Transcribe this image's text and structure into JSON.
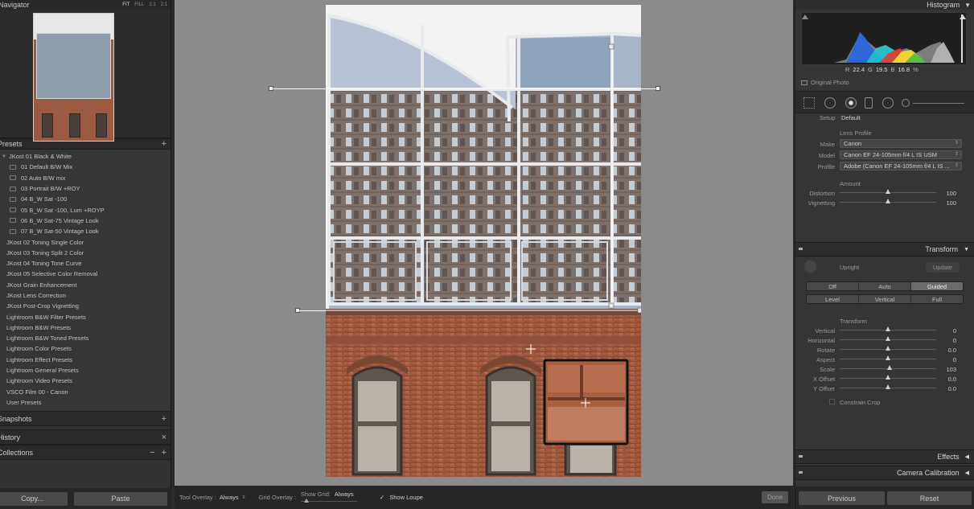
{
  "left": {
    "navigator": {
      "title": "Navigator",
      "modes": [
        "FIT",
        "FILL",
        "1:1",
        "2:1"
      ],
      "active_mode": "FIT"
    },
    "presets": {
      "title": "Presets",
      "add": "+",
      "items": [
        {
          "label": "JKost 01 Black & White",
          "kind": "folder"
        },
        {
          "label": "01 Default B/W Mix",
          "kind": "sub"
        },
        {
          "label": "02 Auto B/W mix",
          "kind": "sub"
        },
        {
          "label": "03 Portrait B/W +ROY",
          "kind": "sub"
        },
        {
          "label": "04 B_W Sat -100",
          "kind": "sub"
        },
        {
          "label": "05 B_W Sat -100, Lum +ROYP",
          "kind": "sub"
        },
        {
          "label": "06 B_W Sat-75 Vintage Look",
          "kind": "sub"
        },
        {
          "label": "07 B_W Sat-50 Vintage Look",
          "kind": "sub"
        },
        {
          "label": "JKost 02 Toning Single Color",
          "kind": "top"
        },
        {
          "label": "JKost 03 Toning Split 2 Color",
          "kind": "top"
        },
        {
          "label": "JKost 04 Toning Tone Curve",
          "kind": "top"
        },
        {
          "label": "JKost 05 Selective Color Removal",
          "kind": "top"
        },
        {
          "label": "JKost Grain Enhancement",
          "kind": "top"
        },
        {
          "label": "JKost Lens Correction",
          "kind": "top"
        },
        {
          "label": "JKost Post-Crop Vignetting",
          "kind": "top"
        },
        {
          "label": "Lightroom B&W Filter Presets",
          "kind": "top"
        },
        {
          "label": "Lightroom B&W Presets",
          "kind": "top"
        },
        {
          "label": "Lightroom B&W Toned Presets",
          "kind": "top"
        },
        {
          "label": "Lightroom Color Presets",
          "kind": "top"
        },
        {
          "label": "Lightroom Effect Presets",
          "kind": "top"
        },
        {
          "label": "Lightroom General Presets",
          "kind": "top"
        },
        {
          "label": "Lightroom Video Presets",
          "kind": "top"
        },
        {
          "label": "VSCO Film 00 - Canon",
          "kind": "top"
        },
        {
          "label": "User Presets",
          "kind": "top"
        }
      ]
    },
    "snapshots": {
      "title": "Snapshots",
      "add": "+"
    },
    "history": {
      "title": "History",
      "clear": "×"
    },
    "collections": {
      "title": "Collections",
      "minus": "−",
      "add": "+"
    },
    "copy_label": "Copy...",
    "paste_label": "Paste"
  },
  "toolbar": {
    "tool_overlay_label": "Tool Overlay :",
    "tool_overlay_value": "Always",
    "grid_overlay_label": "Grid Overlay :",
    "show_grid_label": "Show Grid:",
    "show_grid_value": "Always",
    "show_loupe_label": "Show Loupe",
    "show_loupe_checked": true,
    "done_label": "Done"
  },
  "right": {
    "histogram": {
      "title": "Histogram",
      "r_label": "R",
      "r_value": "22.4",
      "g_label": "G",
      "g_value": "19.5",
      "b_label": "B",
      "b_value": "16.8",
      "unit": "%",
      "original_photo": "Original Photo"
    },
    "lens": {
      "setup_label": "Setup",
      "setup_value": "Default",
      "profile_title": "Lens Profile",
      "make_label": "Make",
      "make_value": "Canon",
      "model_label": "Model",
      "model_value": "Canon EF 24-105mm f/4 L IS USM",
      "profile_label": "Profile",
      "profile_value": "Adobe (Canon EF 24-105mm f/4 L IS ...",
      "amount_title": "Amount",
      "distortion_label": "Distortion",
      "distortion_value": "100",
      "distortion_level": 0.5,
      "vignetting_label": "Vignetting",
      "vignetting_value": "100",
      "vignetting_level": 0.5
    },
    "transform": {
      "title": "Transform",
      "upright_label": "Upright",
      "update_label": "Update",
      "modes_row1": [
        "Off",
        "Auto",
        "Guided"
      ],
      "modes_row2": [
        "Level",
        "Vertical",
        "Full"
      ],
      "active_mode": "Guided",
      "subtitle": "Transform",
      "sliders": [
        {
          "label": "Vertical",
          "value": "0",
          "level": 0.5
        },
        {
          "label": "Horizontal",
          "value": "0",
          "level": 0.5
        },
        {
          "label": "Rotate",
          "value": "0.0",
          "level": 0.5
        },
        {
          "label": "Aspect",
          "value": "0",
          "level": 0.5
        },
        {
          "label": "Scale",
          "value": "103",
          "level": 0.515
        },
        {
          "label": "X Offset",
          "value": "0.0",
          "level": 0.5
        },
        {
          "label": "Y Offset",
          "value": "0.0",
          "level": 0.5
        }
      ],
      "constrain_crop": "Constrain Crop"
    },
    "effects_title": "Effects",
    "camera_calibration_title": "Camera Calibration",
    "previous_label": "Previous",
    "reset_label": "Reset"
  }
}
